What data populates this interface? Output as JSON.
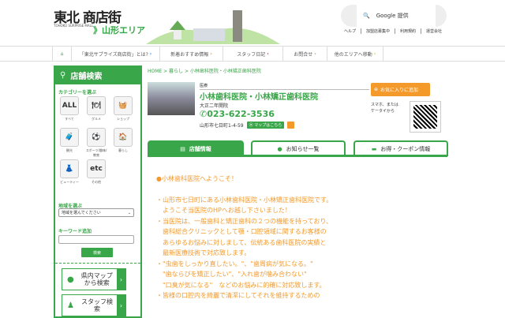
{
  "header": {
    "logo_main": "東北  商店街",
    "logo_sub": "TOHOKU SURPRISE MALL",
    "logo_area": "》山形エリア",
    "search_placeholder": "Google 提供",
    "links": [
      "ヘルプ",
      "加盟店募集中",
      "利用規約",
      "運営会社"
    ]
  },
  "nav": {
    "items": [
      "「東北サプライズ商店街」とは?",
      "新着おすすめ情報",
      "スタッフ日記",
      "お問合せ",
      "他のエリアへ移動"
    ]
  },
  "sidebar": {
    "title": "店舗検索",
    "category_label": "カテゴリーを選ぶ",
    "categories": [
      {
        "icon": "ALL",
        "label": "すべて"
      },
      {
        "icon": "🍽",
        "label": "グルメ"
      },
      {
        "icon": "🧺",
        "label": "ショップ"
      },
      {
        "icon": "🧳",
        "label": "観光"
      },
      {
        "icon": "⚽",
        "label": "スポーツ/趣味/教育"
      },
      {
        "icon": "🏠",
        "label": "暮らし"
      },
      {
        "icon": "👗",
        "label": "ビューティー"
      },
      {
        "icon": "etc",
        "label": "その他"
      }
    ],
    "region_label": "地域を選ぶ",
    "region_value": "地域を選んでください",
    "keyword_label": "キーワード追加",
    "keyword_value": "",
    "search_button": "検索",
    "map_search": "県内マップから検索",
    "staff_search": "スタッフ検索"
  },
  "breadcrumb": "HOME > 暮らし > 小林歯科医院・小林矯正歯科医院",
  "shop": {
    "category": "医療",
    "name": "小林歯科医院・小林矯正歯科医院",
    "established": "大正二年開院",
    "tel": "023-622-3536",
    "address": "山形市七日町1-4-59",
    "map_button": "マップはこちら",
    "fav_button": "お気に入りに追加",
    "mobile_text": "スマホ、または\nケータイから"
  },
  "tabs": [
    "店舗情報",
    "お知らせ一覧",
    "お得・クーポン情報"
  ],
  "content": {
    "heading": "●小林歯科医院へようこそ！",
    "lines": [
      "・山形市七日町にある小林歯科医院・小林矯正歯科医院です。",
      "　ようこそ当医院のHPへお越し下さいました！",
      "・当医院は、一般歯科と矯正歯科の２つの機能を持っており、",
      "　歯科総合クリニックとして顎・口腔領域に関するお客様の",
      "　あらゆるお悩みに対しまして、伝統ある歯科医院の実績と",
      "　最新医療技術で対応致します。",
      "・\"虫歯をしっかり直したい。\"、\"歯周病が気になる。\"",
      "　\"歯ならびを矯正したい\"、\"入れ歯が噛み合わない\"",
      "　\"口臭が気になる\"　などのお悩みに的確に対応致します。",
      "・皆様の口腔内を綺麗で清潔にしてそれを維持するための"
    ]
  },
  "colors": {
    "green": "#3aa64a",
    "orange": "#f39a2b"
  }
}
